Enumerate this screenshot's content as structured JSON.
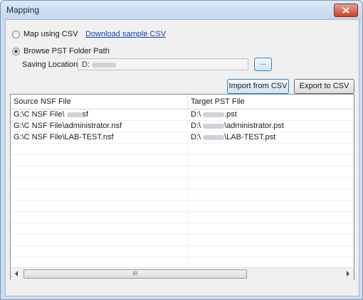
{
  "window": {
    "title": "Mapping"
  },
  "options": {
    "map_csv_label": "Map using CSV",
    "map_csv_selected": false,
    "download_link": "Download sample CSV",
    "browse_label": "Browse PST Folder Path",
    "browse_selected": true,
    "saving_location_label": "Saving Location :",
    "saving_location_value": "D:",
    "browse_button": "..."
  },
  "actions": {
    "import_label": "Import from CSV",
    "export_label": "Export to CSV"
  },
  "table": {
    "columns": [
      "Source NSF File",
      "Target PST File"
    ],
    "rows": [
      {
        "source_prefix": "G:\\C NSF File\\",
        "source_suffix": "sf",
        "source_blur": true,
        "target_prefix": "D:\\",
        "target_suffix": ".pst",
        "target_blur": true
      },
      {
        "source_prefix": "G:\\C NSF File\\administrator.nsf",
        "source_suffix": "",
        "source_blur": false,
        "target_prefix": "D:\\",
        "target_suffix": "\\administrator.pst",
        "target_blur": true
      },
      {
        "source_prefix": "G:\\C NSF File\\LAB-TEST.nsf",
        "source_suffix": "",
        "source_blur": false,
        "target_prefix": "D:\\",
        "target_suffix": "\\LAB-TEST.pst",
        "target_blur": true
      }
    ],
    "empty_rows": 13,
    "scroll_thumb_glyph": "III"
  },
  "icons": {
    "close": "close-icon",
    "scroll_left": "arrow-left-icon",
    "scroll_right": "arrow-right-icon"
  }
}
